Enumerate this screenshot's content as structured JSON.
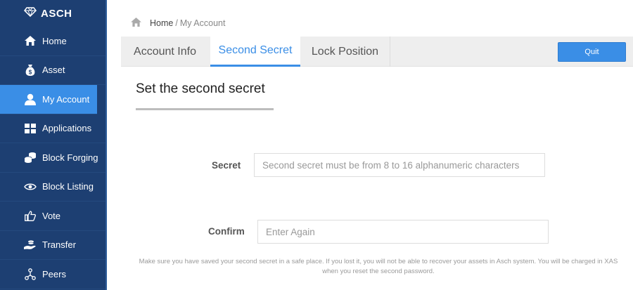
{
  "brand": {
    "name": "ASCH",
    "icon": "diamond-icon"
  },
  "sidebar": {
    "items": [
      {
        "label": "Home",
        "icon": "home-icon"
      },
      {
        "label": "Asset",
        "icon": "money-bag-icon"
      },
      {
        "label": "My Account",
        "icon": "user-icon",
        "active": true
      },
      {
        "label": "Applications",
        "icon": "grid-icon"
      },
      {
        "label": "Block Forging",
        "icon": "coins-icon"
      },
      {
        "label": "Block Listing",
        "icon": "eye-icon"
      },
      {
        "label": "Vote",
        "icon": "thumbs-up-icon"
      },
      {
        "label": "Transfer",
        "icon": "hand-coin-icon"
      },
      {
        "label": "Peers",
        "icon": "network-icon"
      }
    ]
  },
  "breadcrumb": {
    "home": "Home",
    "separator": "/",
    "current": "My Account"
  },
  "tabs": [
    {
      "label": "Account Info"
    },
    {
      "label": "Second Secret",
      "active": true
    },
    {
      "label": "Lock Position"
    }
  ],
  "header": {
    "quit_label": "Quit"
  },
  "main": {
    "title": "Set the second secret",
    "secret_label": "Secret",
    "secret_placeholder": "Second secret must be from 8 to 16 alphanumeric characters",
    "confirm_label": "Confirm",
    "confirm_placeholder": "Enter Again",
    "note": "Make sure you have saved your second secret in a safe place. If you lost it, you will not be able to recover your assets in Asch system. You will be charged in XAS when you reset the second password."
  },
  "colors": {
    "sidebar": "#1d3f72",
    "accent": "#3a8ee6",
    "tabbar": "#eeeeee"
  }
}
